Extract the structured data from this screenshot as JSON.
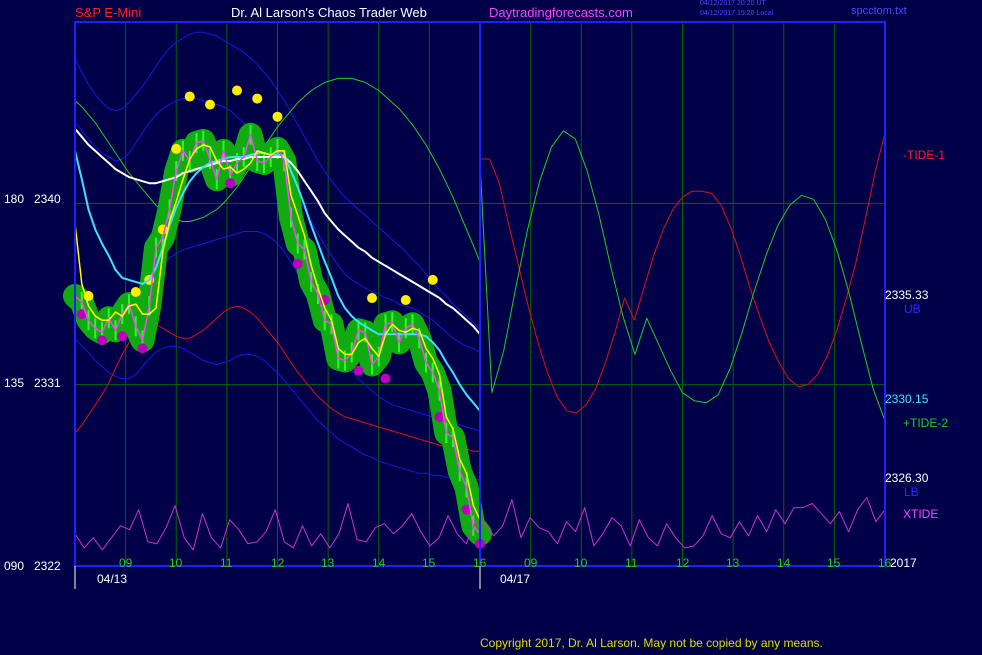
{
  "header": {
    "instrument": "S&P E-Mini",
    "title": "Dr. Al Larson's Chaos Trader Web",
    "website": "Daytradingforecasts.com",
    "stamp_line1": "04/12/2017 20:20 UT",
    "stamp_line2": "04/12/2017 15:20 Local",
    "filename": "spcctom.txt"
  },
  "footer": {
    "copyright": "Copyright 2017, Dr. Al Larson. May not be copied by any means."
  },
  "colors": {
    "background": "#000048",
    "frame": "#2020ff",
    "grid": "#006600",
    "price": "#ff40ff",
    "ema_short": "#ffff00",
    "ema_mid": "#40e0ff",
    "ema_long": "#ffffff",
    "bands": "#1818e0",
    "tide1": "#dd1111",
    "tide2": "#22cc22",
    "xtide": "#cc33cc",
    "blob": "#11aa11",
    "high_dot": "#ffee00",
    "low_dot": "#bb00bb"
  },
  "chart_data": {
    "type": "line",
    "title": "S&P E-Mini",
    "ylim": [
      2322,
      2349
    ],
    "y_ticks": [
      {
        "left": "180",
        "value": "2340"
      },
      {
        "left": "135",
        "value": "2331"
      },
      {
        "left": "090",
        "value": "2322"
      }
    ],
    "x_ticks_day1": [
      "09",
      "10",
      "11",
      "12",
      "13",
      "14",
      "15",
      "16"
    ],
    "x_ticks_day2": [
      "09",
      "10",
      "11",
      "12",
      "13",
      "14",
      "15",
      "16"
    ],
    "dates": [
      "04/13",
      "04/17"
    ],
    "year_label": "2017",
    "right_labels": {
      "tide1": "-TIDE-1",
      "ub_value": "2335.33",
      "ub": "UB",
      "mid_value": "2330.15",
      "tide2": "+TIDE-2",
      "lb_value": "2326.30",
      "lb": "LB",
      "xtide": "XTIDE"
    },
    "series": [
      {
        "key": "price",
        "values": [
          2335.4,
          2335.1,
          2334.2,
          2333.8,
          2333.6,
          2334.3,
          2333.7,
          2334.5,
          2335.0,
          2333.9,
          2333.2,
          2334.9,
          2337.8,
          2338.3,
          2339.7,
          2341.6,
          2342.6,
          2342.1,
          2343.0,
          2343.1,
          2342.2,
          2341.2,
          2342.6,
          2341.4,
          2342.0,
          2342.3,
          2343.4,
          2342.1,
          2342.0,
          2342.3,
          2342.7,
          2342.1,
          2339.3,
          2338.0,
          2337.7,
          2336.1,
          2335.5,
          2334.2,
          2334.0,
          2332.3,
          2332.2,
          2332.6,
          2333.7,
          2333.6,
          2332.0,
          2332.4,
          2334.0,
          2334.1,
          2333.1,
          2333.8,
          2334.0,
          2333.3,
          2332.1,
          2331.6,
          2330.7,
          2328.6,
          2328.4,
          2326.7,
          2325.9,
          2324.0,
          2323.6
        ]
      },
      {
        "key": "ema_short",
        "values": [
          2339.0,
          2336.0,
          2334.9,
          2334.4,
          2334.2,
          2334.2,
          2334.6,
          2334.4,
          2334.9,
          2335.0,
          2334.5,
          2334.5,
          2334.8,
          2337.6,
          2339.1,
          2340.1,
          2341.2,
          2342.2,
          2342.7,
          2342.9,
          2342.8,
          2342.1,
          2341.7,
          2341.8,
          2341.5,
          2341.7,
          2342.0,
          2342.6,
          2342.5,
          2342.4,
          2342.6,
          2342.6,
          2340.4,
          2339.4,
          2338.4,
          2336.9,
          2335.8,
          2334.8,
          2334.2,
          2332.8,
          2332.5,
          2332.5,
          2333.1,
          2333.3,
          2332.8,
          2332.4,
          2333.5,
          2334.0,
          2333.7,
          2333.6,
          2333.8,
          2333.7,
          2332.8,
          2332.3,
          2331.5,
          2329.4,
          2328.8,
          2327.3,
          2326.6,
          2325.0,
          2324.3
        ]
      },
      {
        "key": "ema_mid",
        "values": [
          2342.6,
          2341.2,
          2339.7,
          2338.7,
          2338.0,
          2337.4,
          2336.7,
          2336.3,
          2336.2,
          2336.1,
          2336.0,
          2336.2,
          2336.8,
          2337.8,
          2338.9,
          2339.8,
          2340.5,
          2341.1,
          2341.5,
          2341.8,
          2342.0,
          2342.1,
          2342.2,
          2342.3,
          2342.3,
          2342.3,
          2342.4,
          2342.5,
          2342.5,
          2342.4,
          2342.4,
          2342.4,
          2341.6,
          2340.8,
          2339.9,
          2338.9,
          2338.0,
          2337.1,
          2336.3,
          2335.4,
          2334.8,
          2334.4,
          2334.1,
          2333.9,
          2333.7,
          2333.5,
          2333.5,
          2333.5,
          2333.5,
          2333.5,
          2333.5,
          2333.5,
          2333.4,
          2333.1,
          2332.7,
          2332.1,
          2331.6,
          2331.0,
          2330.5,
          2330.1,
          2329.7
        ]
      },
      {
        "key": "ema_long",
        "values": [
          2343.7,
          2343.3,
          2342.9,
          2342.6,
          2342.3,
          2342.0,
          2341.7,
          2341.5,
          2341.3,
          2341.2,
          2341.1,
          2341.0,
          2341.0,
          2341.1,
          2341.2,
          2341.3,
          2341.5,
          2341.6,
          2341.7,
          2341.8,
          2341.9,
          2342.0,
          2342.1,
          2342.1,
          2342.2,
          2342.2,
          2342.3,
          2342.3,
          2342.3,
          2342.3,
          2342.3,
          2342.3,
          2342.0,
          2341.6,
          2341.1,
          2340.6,
          2340.1,
          2339.5,
          2339.1,
          2338.7,
          2338.4,
          2338.1,
          2337.8,
          2337.6,
          2337.3,
          2337.1,
          2336.9,
          2336.7,
          2336.5,
          2336.3,
          2336.1,
          2335.9,
          2335.7,
          2335.5,
          2335.3,
          2335.0,
          2334.8,
          2334.5,
          2334.2,
          2333.9,
          2333.5
        ]
      },
      {
        "key": "band_upper",
        "values": [
          2347.2,
          2346.5,
          2345.9,
          2345.4,
          2345.0,
          2344.7,
          2344.6,
          2344.7,
          2345.0,
          2345.4,
          2345.8,
          2346.3,
          2346.8,
          2347.3,
          2347.7,
          2348.0,
          2348.2,
          2348.4,
          2348.5,
          2348.5,
          2348.4,
          2348.3,
          2348.1,
          2347.9,
          2347.7,
          2347.5,
          2347.2,
          2346.9,
          2346.5,
          2346.1,
          2345.6,
          2345.1,
          2344.5,
          2343.9,
          2343.3,
          2342.7,
          2342.1,
          2341.6,
          2341.1,
          2340.7,
          2340.3,
          2340.0,
          2339.7,
          2339.4,
          2339.1,
          2338.8,
          2338.5,
          2338.2,
          2337.9,
          2337.6,
          2337.2,
          2336.9,
          2336.5,
          2336.1,
          2335.7,
          2335.4,
          2335.0,
          2334.7,
          2334.4,
          2334.1,
          2333.7
        ]
      },
      {
        "key": "band_inner_upper",
        "values": [
          2344.0,
          2343.6,
          2343.2,
          2342.8,
          2342.5,
          2342.3,
          2342.1,
          2342.2,
          2342.5,
          2343.0,
          2343.5,
          2344.0,
          2344.4,
          2344.7,
          2344.9,
          2345.1,
          2345.2,
          2345.2,
          2345.2,
          2345.1,
          2345.0,
          2344.9,
          2344.8,
          2344.6,
          2344.3,
          2344.0,
          2343.7,
          2343.3,
          2342.9,
          2342.4,
          2341.9,
          2341.4,
          2340.9,
          2340.3,
          2339.7,
          2339.1,
          2338.5,
          2337.9,
          2337.4,
          2336.9,
          2336.5,
          2336.2,
          2336.0,
          2335.8,
          2335.6,
          2335.5,
          2335.3,
          2335.2,
          2335.0,
          2334.9,
          2334.8,
          2334.6,
          2334.4,
          2334.2,
          2333.9,
          2333.6,
          2333.3,
          2333.1,
          2332.9,
          2332.8,
          2332.6
        ]
      },
      {
        "key": "band_inner_lower",
        "values": [
          2334.4,
          2334.1,
          2333.8,
          2333.5,
          2333.3,
          2333.2,
          2333.3,
          2333.7,
          2334.3,
          2334.9,
          2335.5,
          2336.1,
          2336.6,
          2337.0,
          2337.3,
          2337.5,
          2337.7,
          2337.8,
          2337.9,
          2338.0,
          2338.1,
          2338.2,
          2338.3,
          2338.4,
          2338.5,
          2338.6,
          2338.6,
          2338.6,
          2338.5,
          2338.3,
          2338.0,
          2337.6,
          2337.1,
          2336.5,
          2335.9,
          2335.2,
          2334.5,
          2333.8,
          2333.2,
          2332.6,
          2332.1,
          2331.7,
          2331.3,
          2331.0,
          2330.7,
          2330.4,
          2330.2,
          2330.0,
          2329.9,
          2329.8,
          2329.7,
          2329.6,
          2329.5,
          2329.4,
          2329.3,
          2329.2,
          2329.1,
          2329.0,
          2328.9,
          2328.8,
          2328.7
        ]
      },
      {
        "key": "band_lower",
        "values": [
          2333.3,
          2332.9,
          2332.6,
          2332.2,
          2331.9,
          2331.6,
          2331.4,
          2331.3,
          2331.3,
          2331.5,
          2331.9,
          2332.3,
          2332.6,
          2332.8,
          2332.9,
          2332.9,
          2332.8,
          2332.6,
          2332.4,
          2332.2,
          2332.1,
          2332.0,
          2332.1,
          2332.2,
          2332.4,
          2332.5,
          2332.5,
          2332.4,
          2332.2,
          2331.9,
          2331.6,
          2331.2,
          2330.8,
          2330.4,
          2330.0,
          2329.6,
          2329.2,
          2328.9,
          2328.6,
          2328.3,
          2328.1,
          2327.9,
          2327.7,
          2327.5,
          2327.4,
          2327.2,
          2327.1,
          2327.0,
          2326.9,
          2326.8,
          2326.7,
          2326.6,
          2326.6,
          2326.5,
          2326.5,
          2326.4,
          2326.4,
          2326.3,
          2326.3,
          2326.3,
          2326.3
        ]
      },
      {
        "key": "band_red",
        "values": [
          2328.6,
          2329.0,
          2329.5,
          2330.0,
          2330.5,
          2331.1,
          2331.8,
          2332.5,
          2333.1,
          2333.6,
          2333.9,
          2334.0,
          2334.0,
          2333.8,
          2333.6,
          2333.4,
          2333.3,
          2333.3,
          2333.5,
          2333.7,
          2334.0,
          2334.3,
          2334.6,
          2334.8,
          2334.9,
          2334.8,
          2334.6,
          2334.3,
          2333.9,
          2333.5,
          2333.1,
          2332.6,
          2332.1,
          2331.6,
          2331.2,
          2330.8,
          2330.4,
          2330.1,
          2329.8,
          2329.6,
          2329.4,
          2329.3,
          2329.2,
          2329.1,
          2329.0,
          2328.9,
          2328.8,
          2328.7,
          2328.6,
          2328.5,
          2328.4,
          2328.3,
          2328.2,
          2328.1,
          2328.0,
          2327.9,
          2327.9,
          2327.8,
          2327.8,
          2327.7,
          2327.7
        ]
      },
      {
        "key": "band_green",
        "values": [
          2345.1,
          2344.8,
          2344.4,
          2344.0,
          2343.5,
          2343.0,
          2342.5,
          2342.0,
          2341.5,
          2341.1,
          2340.7,
          2340.3,
          2339.9,
          2339.6,
          2339.4,
          2339.2,
          2339.1,
          2339.1,
          2339.2,
          2339.3,
          2339.5,
          2339.7,
          2340.0,
          2340.4,
          2340.8,
          2341.3,
          2341.8,
          2342.3,
          2342.8,
          2343.3,
          2343.8,
          2344.2,
          2344.6,
          2345.0,
          2345.3,
          2345.6,
          2345.8,
          2346.0,
          2346.1,
          2346.2,
          2346.2,
          2346.2,
          2346.1,
          2346.0,
          2345.8,
          2345.6,
          2345.3,
          2345.0,
          2344.7,
          2344.3,
          2343.9,
          2343.4,
          2342.9,
          2342.3,
          2341.7,
          2341.0,
          2340.3,
          2339.5,
          2338.7,
          2337.9,
          2337.1
        ]
      },
      {
        "key": "tide1_forecast",
        "values": [
          2342.2,
          2342.2,
          2341.0,
          2338.9,
          2336.9,
          2334.9,
          2333.1,
          2331.6,
          2330.4,
          2329.7,
          2329.6,
          2330.0,
          2330.8,
          2332.1,
          2333.6,
          2335.3,
          2334.2,
          2335.8,
          2337.4,
          2338.7,
          2339.7,
          2340.3,
          2340.6,
          2340.6,
          2340.5,
          2339.9,
          2338.8,
          2337.4,
          2335.8,
          2334.4,
          2333.1,
          2332.1,
          2331.3,
          2330.9,
          2331.0,
          2331.5,
          2332.4,
          2333.7,
          2335.3,
          2337.1,
          2339.3,
          2341.6,
          2343.5
        ]
      },
      {
        "key": "tide2_forecast",
        "values": [
          2342.0,
          2330.6,
          2332.7,
          2335.8,
          2338.7,
          2341.1,
          2342.8,
          2343.6,
          2343.2,
          2341.6,
          2339.4,
          2336.8,
          2334.4,
          2332.5,
          2334.3,
          2333.0,
          2331.7,
          2330.6,
          2330.2,
          2330.1,
          2330.5,
          2331.8,
          2333.6,
          2335.6,
          2337.4,
          2338.9,
          2339.9,
          2340.4,
          2340.2,
          2339.2,
          2337.6,
          2335.5,
          2333.1,
          2330.8,
          2329.2
        ]
      },
      {
        "key": "xtide",
        "values": [
          2323.6,
          2322.9,
          2323.4,
          2322.8,
          2323.4,
          2324.0,
          2323.8,
          2324.8,
          2323.2,
          2323.1,
          2323.9,
          2325.0,
          2323.4,
          2322.8,
          2324.6,
          2323.4,
          2322.9,
          2324.3,
          2323.8,
          2323.1,
          2323.2,
          2323.7,
          2324.8,
          2323.2,
          2322.9,
          2324.0,
          2323.0,
          2323.6,
          2322.9,
          2323.6,
          2325.1,
          2323.3,
          2323.2,
          2323.9,
          2324.1,
          2323.6,
          2324.0,
          2324.6,
          2323.7,
          2323.0,
          2323.4,
          2324.5,
          2323.6,
          2323.1,
          2324.2,
          2324.1,
          2323.5,
          2324.0,
          2325.3,
          2323.4,
          2324.4,
          2323.9,
          2323.7,
          2323.1,
          2324.2,
          2323.7,
          2324.9,
          2323.0,
          2323.6,
          2324.4,
          2324.0,
          2323.0,
          2324.3,
          2323.4,
          2323.0,
          2324.1,
          2323.4,
          2322.9,
          2323.0,
          2323.5,
          2324.5,
          2323.6,
          2323.4,
          2324.2,
          2323.5,
          2324.5,
          2323.7,
          2324.8,
          2324.1,
          2324.9,
          2324.9,
          2325.1,
          2324.6,
          2324.1,
          2324.7,
          2323.7,
          2324.8,
          2325.4,
          2324.2,
          2324.8
        ]
      }
    ],
    "highlight_points": [
      {
        "kind": "high",
        "points": [
          [
            2,
            2335.4
          ],
          [
            9,
            2335.6
          ],
          [
            11,
            2336.2
          ],
          [
            13,
            2338.7
          ],
          [
            15,
            2342.7
          ],
          [
            17,
            2345.3
          ],
          [
            20,
            2344.9
          ],
          [
            24,
            2345.6
          ],
          [
            27,
            2345.2
          ],
          [
            30,
            2344.3
          ],
          [
            44,
            2335.3
          ],
          [
            49,
            2335.2
          ],
          [
            53,
            2336.2
          ]
        ]
      },
      {
        "kind": "low",
        "points": [
          [
            1,
            2334.5
          ],
          [
            4,
            2333.2
          ],
          [
            7,
            2333.4
          ],
          [
            10,
            2332.8
          ],
          [
            23,
            2341.0
          ],
          [
            33,
            2337.0
          ],
          [
            37,
            2335.2
          ],
          [
            42,
            2331.7
          ],
          [
            46,
            2331.3
          ],
          [
            54,
            2329.4
          ],
          [
            58,
            2324.8
          ],
          [
            60,
            2323.1
          ]
        ]
      }
    ]
  }
}
